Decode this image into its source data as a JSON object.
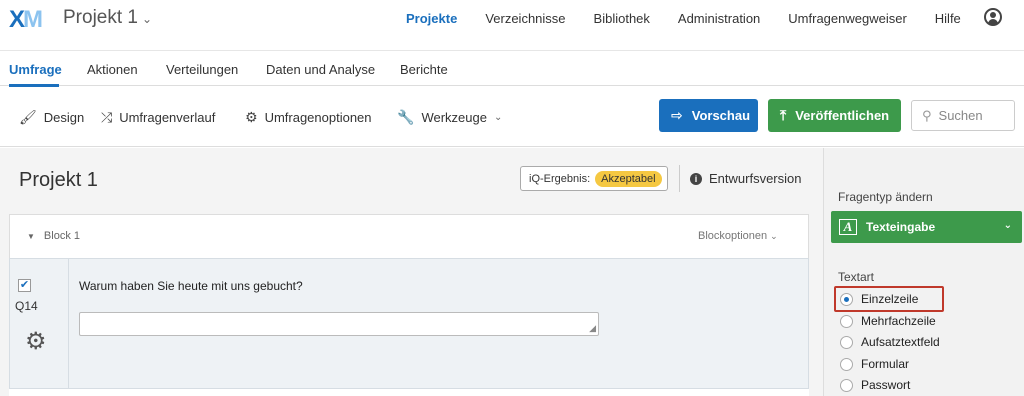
{
  "topbar": {
    "logo_main": "X",
    "logo_accent": "M",
    "project_title": "Projekt 1",
    "nav": [
      "Projekte",
      "Verzeichnisse",
      "Bibliothek",
      "Administration",
      "Umfragenwegweiser",
      "Hilfe"
    ],
    "nav_active": "Projekte"
  },
  "tabs": {
    "items": [
      "Umfrage",
      "Aktionen",
      "Verteilungen",
      "Daten und Analyse",
      "Berichte"
    ],
    "active": "Umfrage"
  },
  "toolbar": {
    "design": "Design",
    "flow": "Umfragenverlauf",
    "options": "Umfragenoptionen",
    "tools": "Werkzeuge",
    "preview": "Vorschau",
    "publish": "Veröffentlichen",
    "search_placeholder": "Suchen"
  },
  "survey": {
    "title": "Projekt 1",
    "iq_label": "iQ-Ergebnis:",
    "iq_badge": "Akzeptabel",
    "draft": "Entwurfsversion",
    "block_name": "Block 1",
    "block_options": "Blockoptionen",
    "question_number": "Q14",
    "question_text": "Warum haben Sie heute mit uns gebucht?"
  },
  "right_panel": {
    "change_type_label": "Fragentyp ändern",
    "question_type": "Texteingabe",
    "textart_label": "Textart",
    "options": [
      "Einzelzeile",
      "Mehrfachzeile",
      "Aufsatztextfeld",
      "Formular",
      "Passwort"
    ],
    "selected": "Einzelzeile"
  },
  "colors": {
    "accent": "#1a6fbd",
    "publish_green": "#3d9a4b",
    "badge_yellow": "#f5c842",
    "highlight_red": "#c0392b"
  }
}
